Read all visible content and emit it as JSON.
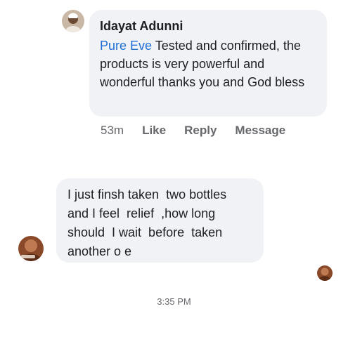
{
  "comment": {
    "author": "Idayat Adunni",
    "mention": "Pure Eve",
    "text": " Tested and confirmed, the products is very powerful and wonderful thanks you and God bless",
    "timestamp": "53m",
    "actions": [
      "Like",
      "Reply",
      "Message"
    ]
  },
  "message": {
    "text": "I just finsh taken  two bottles\nand I feel  relief  ,how long\nshould  I wait  before  taken\nanother o e"
  },
  "time_divider": "3:35 PM",
  "colors": {
    "bubble": "#f0f2f5",
    "mention": "#1f6fd6",
    "meta_text": "#65676b"
  }
}
